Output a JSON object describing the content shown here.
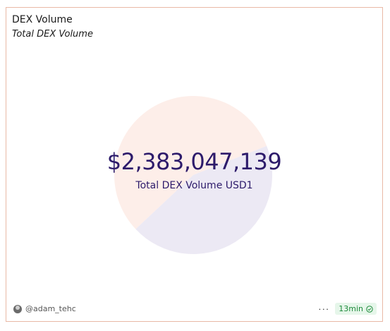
{
  "card": {
    "title": "DEX Volume",
    "subtitle": "Total DEX Volume"
  },
  "counter": {
    "value": "$2,383,047,139",
    "label": "Total DEX Volume USD1"
  },
  "chart_data": {
    "type": "pie",
    "categories": [
      "",
      ""
    ],
    "values": [
      0.56,
      0.44
    ],
    "colors": [
      "#fdeee9",
      "#ece9f4"
    ]
  },
  "footer": {
    "author": "@adam_tehc",
    "more_label": "···",
    "freshness": "13min"
  },
  "colors": {
    "accent": "#2d1b6b",
    "border": "#e9b9a6",
    "fresh": "#1d8a3a"
  }
}
